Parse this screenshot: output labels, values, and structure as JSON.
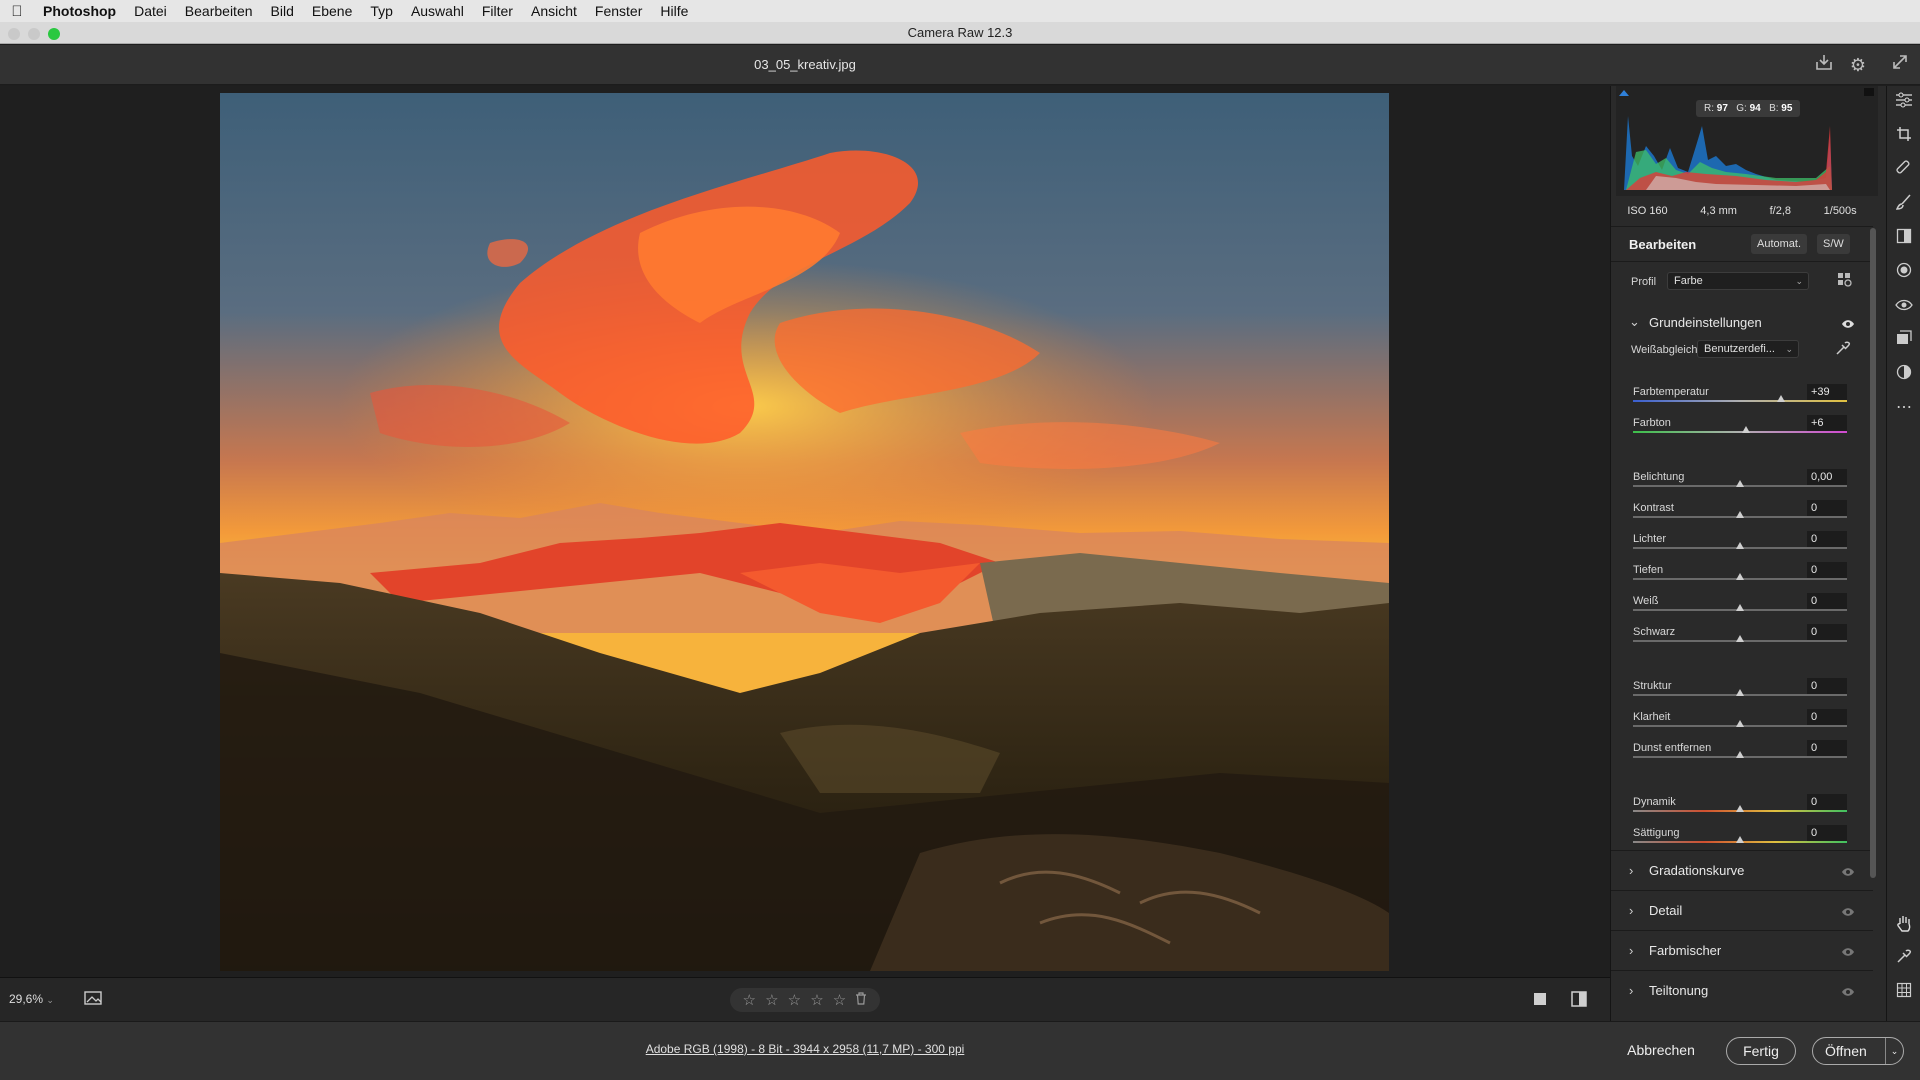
{
  "menubar": {
    "apple_icon": "apple-logo-icon",
    "items": [
      "Photoshop",
      "Datei",
      "Bearbeiten",
      "Bild",
      "Ebene",
      "Typ",
      "Auswahl",
      "Filter",
      "Ansicht",
      "Fenster",
      "Hilfe"
    ]
  },
  "window": {
    "title": "Camera Raw 12.3"
  },
  "header": {
    "filename": "03_05_kreativ.jpg"
  },
  "bottombar": {
    "zoom": "29,6%"
  },
  "footer": {
    "file_info": "Adobe RGB (1998) - 8 Bit - 3944 x 2958 (11,7 MP) - 300 ppi",
    "cancel": "Abbrechen",
    "done": "Fertig",
    "open": "Öffnen"
  },
  "histogram": {
    "r_label": "R:",
    "r": "97",
    "g_label": "G:",
    "g": "94",
    "b_label": "B:",
    "b": "95"
  },
  "exif": {
    "iso": "ISO 160",
    "focal": "4,3 mm",
    "aperture": "f/2,8",
    "shutter": "1/500s"
  },
  "edit": {
    "title": "Bearbeiten",
    "auto": "Automat.",
    "bw": "S/W",
    "profile_label": "Profil",
    "profile_value": "Farbe",
    "basic_title": "Grundeinstellungen",
    "wb_label": "Weißabgleich",
    "wb_value": "Benutzerdefi..."
  },
  "sliders": [
    {
      "label": "Farbtemperatur",
      "value": "+39",
      "level": 0.69
    },
    {
      "label": "Farbton",
      "value": "+6",
      "level": 0.53
    },
    {
      "label": "Belichtung",
      "value": "0,00",
      "level": 0.5
    },
    {
      "label": "Kontrast",
      "value": "0",
      "level": 0.5
    },
    {
      "label": "Lichter",
      "value": "0",
      "level": 0.5
    },
    {
      "label": "Tiefen",
      "value": "0",
      "level": 0.5
    },
    {
      "label": "Weiß",
      "value": "0",
      "level": 0.5
    },
    {
      "label": "Schwarz",
      "value": "0",
      "level": 0.5
    },
    {
      "label": "Struktur",
      "value": "0",
      "level": 0.5
    },
    {
      "label": "Klarheit",
      "value": "0",
      "level": 0.5
    },
    {
      "label": "Dunst entfernen",
      "value": "0",
      "level": 0.5
    },
    {
      "label": "Dynamik",
      "value": "0",
      "level": 0.5
    },
    {
      "label": "Sättigung",
      "value": "0",
      "level": 0.5
    }
  ],
  "sections": [
    "Gradationskurve",
    "Detail",
    "Farbmischer",
    "Teiltonung"
  ]
}
